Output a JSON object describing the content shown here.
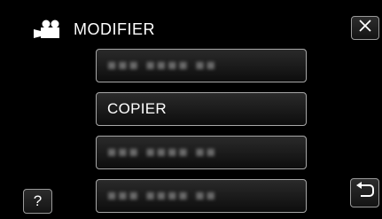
{
  "header": {
    "mode_icon": "video-camera-icon",
    "title": "MODIFIER",
    "close_icon": "close-icon"
  },
  "menu": {
    "items": [
      {
        "label": "■■■ ■■■■ ■■",
        "enabled": false
      },
      {
        "label": "COPIER",
        "enabled": true
      },
      {
        "label": "■■■ ■■■■ ■■",
        "enabled": false
      },
      {
        "label": "■■■ ■■■■ ■■",
        "enabled": false
      }
    ]
  },
  "footer": {
    "help_label": "?",
    "back_icon": "return-arrow-icon"
  },
  "colors": {
    "background": "#000000",
    "text": "#ffffff",
    "button_border": "#a8a8a8",
    "disabled_text": "#6a6a6a"
  }
}
